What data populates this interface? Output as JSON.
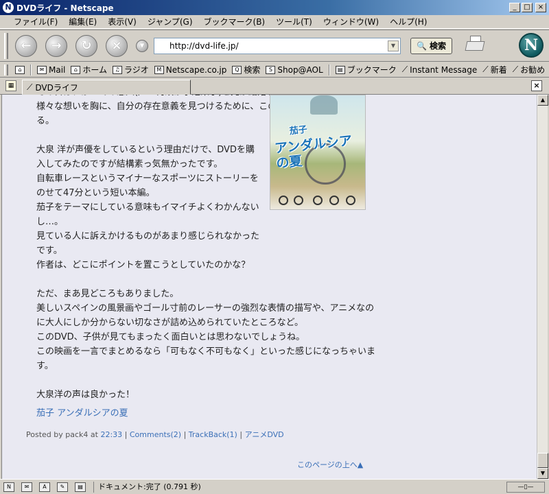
{
  "window": {
    "title": "DVDライフ - Netscape"
  },
  "menu": [
    "ファイル(F)",
    "編集(E)",
    "表示(V)",
    "ジャンプ(G)",
    "ブックマーク(B)",
    "ツール(T)",
    "ウィンドウ(W)",
    "ヘルプ(H)"
  ],
  "nav": {
    "url": "http://dvd-life.jp/",
    "search_label": "検索"
  },
  "personal": [
    "Mail",
    "ホーム",
    "ラジオ",
    "Netscape.co.jp",
    "検索",
    "Shop@AOL",
    "ブックマーク",
    "Instant Message",
    "新着",
    "お勧め"
  ],
  "tab": {
    "label": "DVDライフ"
  },
  "post": {
    "paragraphs": [
      "その日は、かつての恋人(声：何故か小池栄子)と兄が結婚する日。\n様々な想いを胸に、自分の存在意義を見つけるために、このレースにすべてをかける。",
      "大泉 洋が声優をしているという理由だけで、DVDを購入してみたのですが結構素っ気無かったです。\n自転車レースというマイナーなスポーツにストーリーをのせて47分という短い本編。\n茄子をテーマにしている意味もイマイチよくわかんないし…。\n見ている人に訴えかけるものがあまり感じられなかったです。\n作者は、どこにポイントを置こうとしていたのかな？",
      "ただ、まあ見どころもありました。\n美しいスペインの風景画やゴール寸前のレーサーの強烈な表情の描写や、アニメなのに大人にしか分からない切なさが詰め込められていたところなど。\nこのDVD、子供が見てもまったく面白いとは思わないでしょうね。\nこの映画を一言でまとめるなら「可もなく不可もなく」といった感じになっちゃいます。",
      "大泉洋の声は良かった！"
    ],
    "cover_title_small": "茄子",
    "cover_title_main": "アンダルシアの夏",
    "movie_link": "茄子 アンダルシアの夏",
    "meta": {
      "posted_by": "Posted by pack4 at",
      "time": "22:33",
      "comments": "Comments(2)",
      "trackback": "TrackBack(1)",
      "category": "アニメDVD"
    },
    "page_top": "このページの上へ▲"
  },
  "status": {
    "text": "ドキュメント:完了 (0.791 秒)"
  }
}
